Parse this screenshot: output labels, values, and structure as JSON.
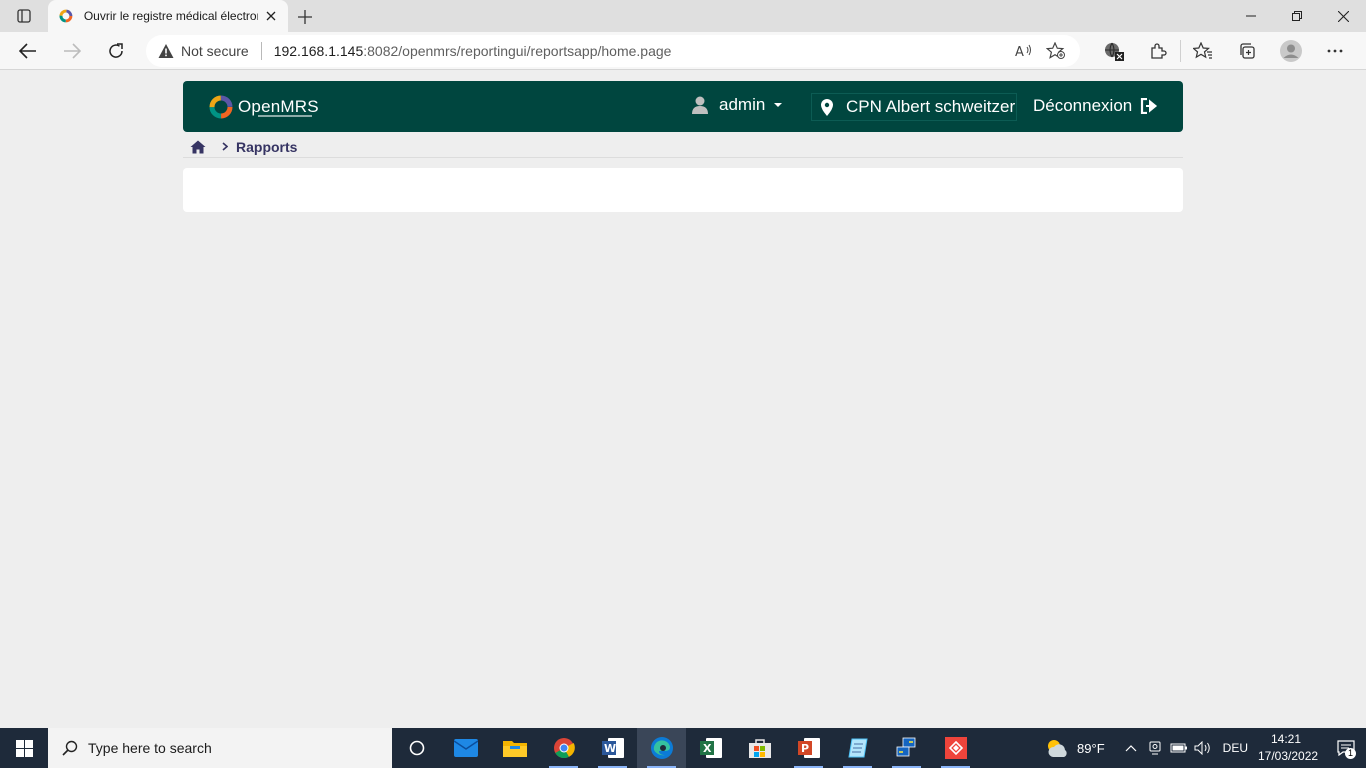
{
  "browser": {
    "tab_title": "Ouvrir le registre médical électronique",
    "not_secure": "Not secure",
    "url_host": "192.168.1.145",
    "url_rest": ":8082/openmrs/reportingui/reportsapp/home.page"
  },
  "header": {
    "logo_text": "OpenMRS",
    "user": "admin",
    "location": "CPN Albert schweitzer",
    "logout": "Déconnexion"
  },
  "breadcrumb": {
    "current": "Rapports"
  },
  "taskbar": {
    "search_placeholder": "Type here to search",
    "weather_temp": "89°F",
    "language": "DEU",
    "time": "14:21",
    "date": "17/03/2022",
    "notification_count": "1"
  },
  "colors": {
    "header_bg": "#00463f",
    "page_bg": "#eeeeee",
    "breadcrumb_text": "#363463"
  }
}
